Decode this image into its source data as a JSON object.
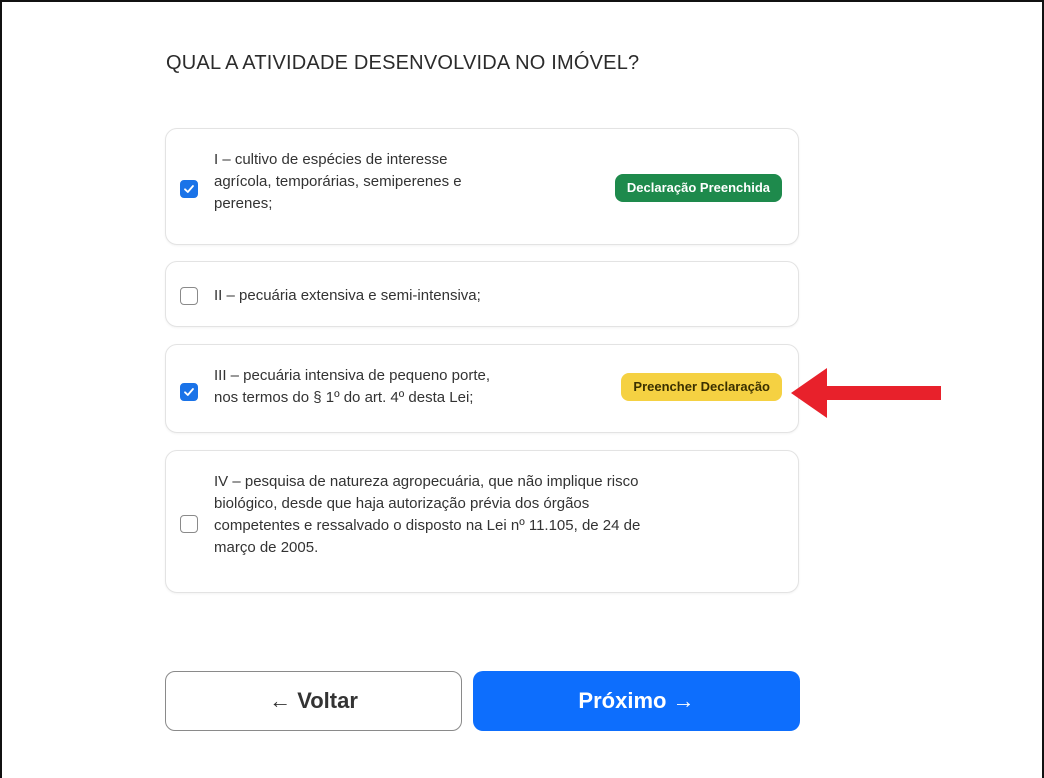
{
  "question": "QUAL A ATIVIDADE DESENVOLVIDA NO IMÓVEL?",
  "options": [
    {
      "lines": [
        "I – cultivo de espécies de interesse",
        "agrícola, temporárias, semiperenes e",
        "perenes;"
      ],
      "checked": true,
      "badge": "Declaração Preenchida"
    },
    {
      "lines": [
        "II – pecuária extensiva e semi-intensiva;"
      ],
      "checked": false
    },
    {
      "lines": [
        "III – pecuária intensiva de pequeno porte,",
        "nos termos do § 1º do art. 4º desta Lei;"
      ],
      "checked": true,
      "badge": "Preencher Declaração"
    },
    {
      "lines": [
        "IV – pesquisa de natureza agropecuária, que não implique risco",
        "biológico, desde que haja autorização prévia dos órgãos",
        "competentes e ressalvado o disposto na Lei nº 11.105, de 24 de",
        "março de 2005."
      ],
      "checked": false
    }
  ],
  "buttons": {
    "back": "← Voltar",
    "next": "Próximo →"
  },
  "colors": {
    "checkbox_checked": "#1a73e8",
    "badge_filled": "#1e8a4c",
    "badge_pending": "#f5d142",
    "next_button": "#0d6efd",
    "annotation_arrow": "#e8212b"
  },
  "icons": {
    "checked": "check-icon",
    "annotation": "red-arrow-left-icon"
  }
}
